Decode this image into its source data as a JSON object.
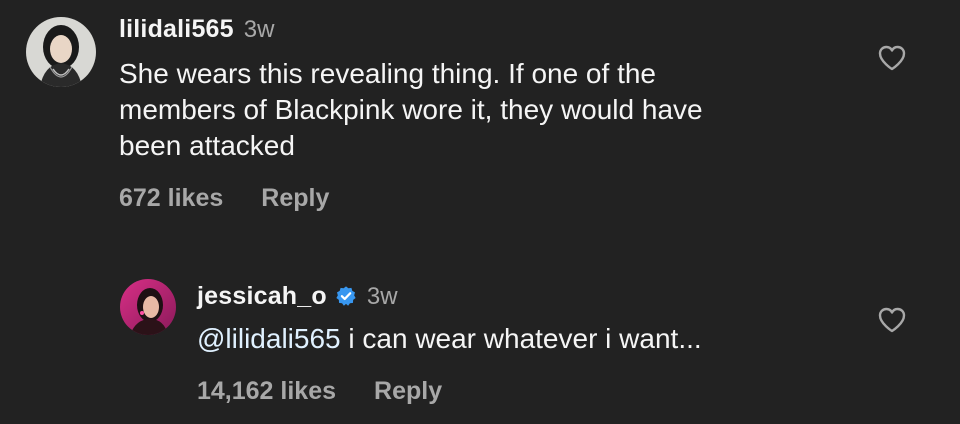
{
  "comments": [
    {
      "username": "lilidali565",
      "time": "3w",
      "text": "She wears this revealing thing. If one of the members of Blackpink wore it, they would have been attacked",
      "lines": [
        "She wears this revealing thing. If one of the",
        "members of Blackpink wore it, they would have",
        "been attacked"
      ],
      "likes": "672 likes",
      "reply_label": "Reply",
      "like_icon": "heart-outline-icon",
      "avatar_icon": "user-avatar"
    },
    {
      "username": "jessicah_o",
      "verified": true,
      "verified_icon": "verified-badge-icon",
      "time": "3w",
      "mention": "@lilidali565",
      "text": " i can wear whatever i want...",
      "likes": "14,162 likes",
      "reply_label": "Reply",
      "like_icon": "heart-outline-icon",
      "avatar_icon": "user-avatar"
    }
  ],
  "colors": {
    "background": "#222222",
    "primary_text": "#f5f5f5",
    "secondary_text": "#a8a8a8",
    "verified_blue": "#3897f0",
    "mention": "#e0f1ff"
  }
}
